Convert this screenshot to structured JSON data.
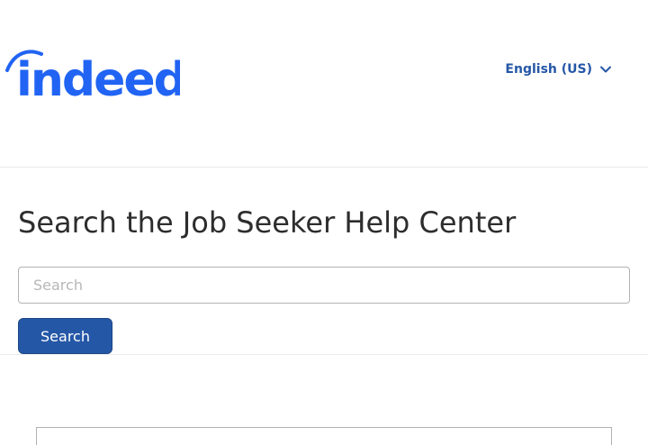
{
  "header": {
    "logo_text": "indeed",
    "language_label": "English (US)",
    "icons": {
      "language_chevron": "chevron-down-icon"
    }
  },
  "main": {
    "title": "Search the Job Seeker Help Center",
    "search": {
      "placeholder": "Search",
      "value": "",
      "button_label": "Search"
    }
  },
  "colors": {
    "brand": "#2164f3",
    "accent": "#2557a7",
    "text": "#2d2d2d"
  }
}
